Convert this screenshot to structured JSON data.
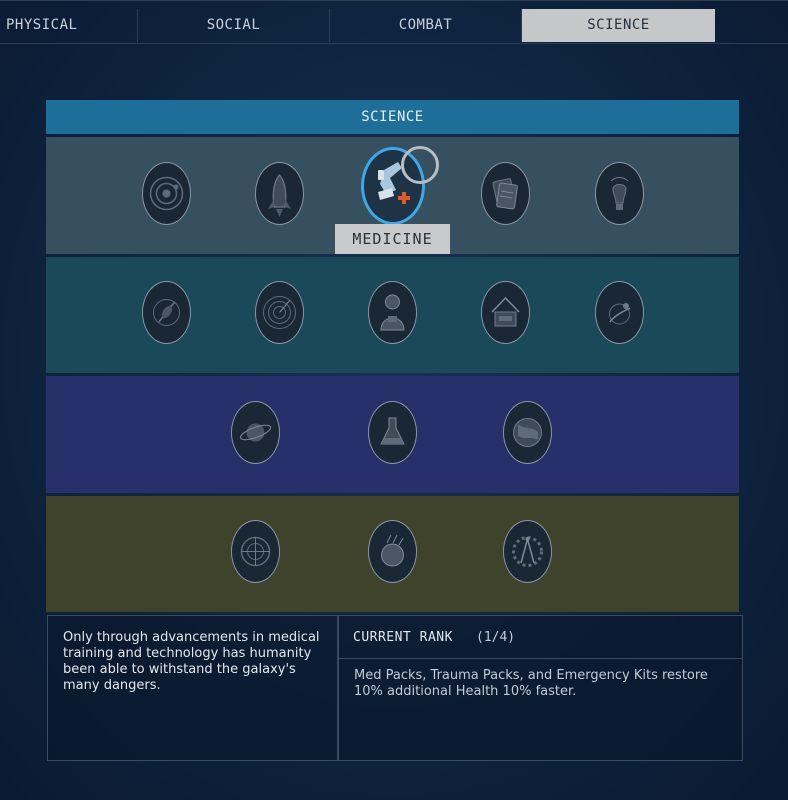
{
  "tabs": [
    {
      "label": "PHYSICAL",
      "active": false
    },
    {
      "label": "SOCIAL",
      "active": false
    },
    {
      "label": "COMBAT",
      "active": false
    },
    {
      "label": "SCIENCE",
      "active": true
    }
  ],
  "section_header": "SCIENCE",
  "tiers": [
    {
      "color": "#37505f",
      "skills": [
        "solar-system-icon",
        "rocket-icon",
        "medicine-icon",
        "research-document-icon",
        "lightbulb-icon"
      ]
    },
    {
      "color": "#1a4a5a",
      "skills": [
        "botany-icon",
        "scanner-radar-icon",
        "spacesuit-icon",
        "outpost-engineering-icon",
        "zoology-icon"
      ]
    },
    {
      "color": "#27306a",
      "skills": [
        "planetary-survey-icon",
        "chemistry-icon",
        "surveying-icon"
      ]
    },
    {
      "color": "#40432c",
      "skills": [
        "targeting-icon",
        "astrodynamics-icon",
        "gear-compass-icon"
      ]
    }
  ],
  "selected_skill": {
    "name": "MEDICINE",
    "icon": "medicine-icon"
  },
  "description": "Only through advancements in medical training and technology has humanity been able to withstand the galaxy's many dangers.",
  "current_rank": {
    "label": "CURRENT RANK",
    "count": "(1/4)",
    "effect": "Med Packs, Trauma Packs, and Emergency Kits restore 10% additional Health 10% faster."
  },
  "colors": {
    "header": "#1d6f9a",
    "active_tab": "#c5c7c9",
    "selection_ring": "#3fa8e6",
    "medicine_cross": "#e05a2b"
  }
}
